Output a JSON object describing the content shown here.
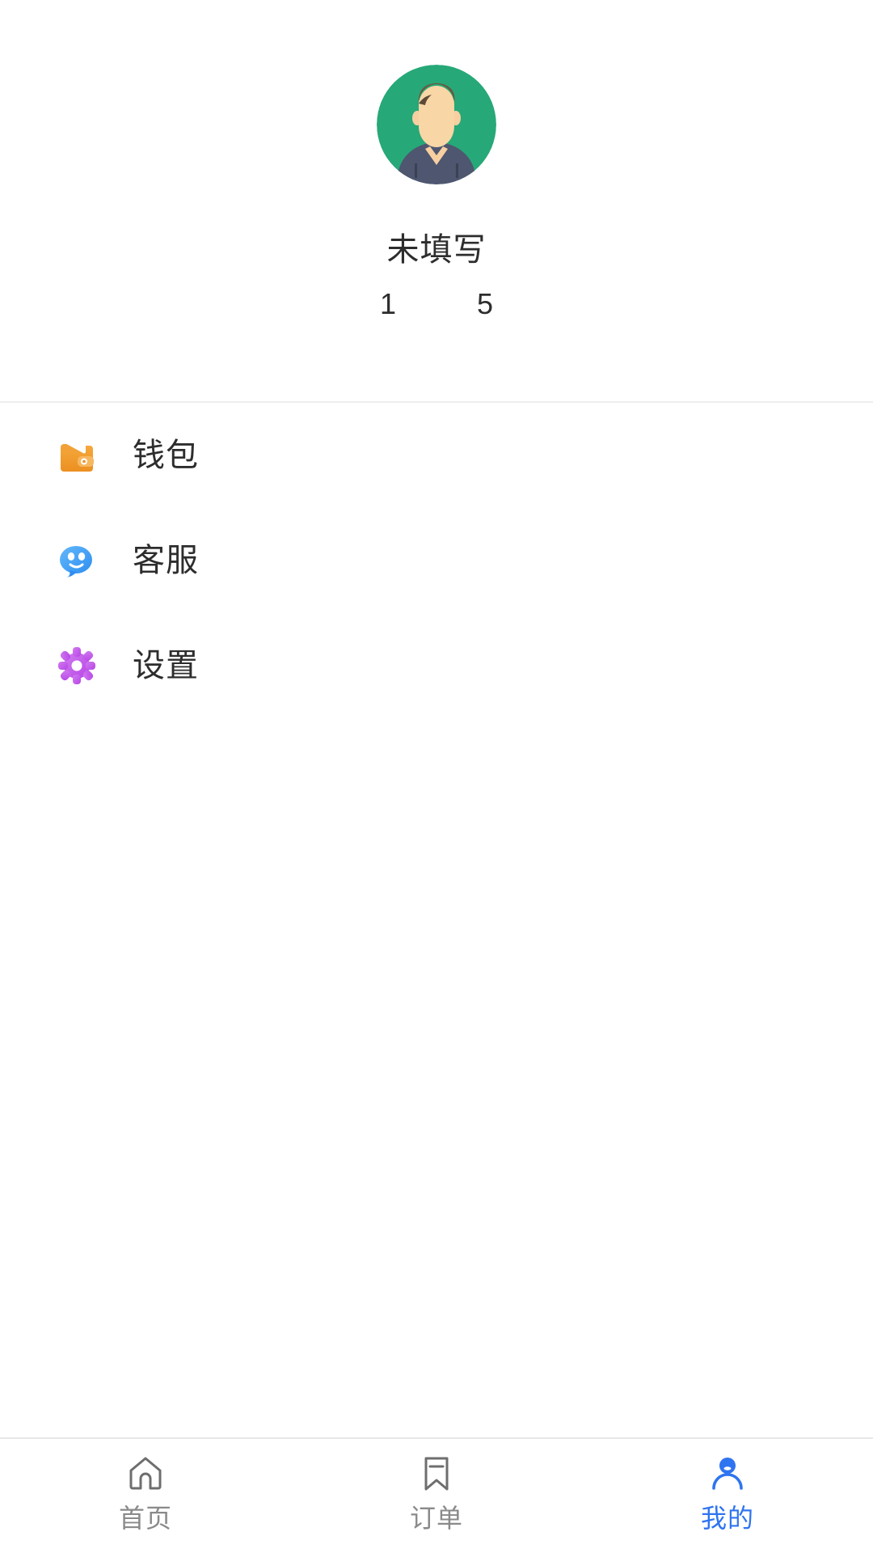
{
  "screen": {
    "name": "mine-profile-screen",
    "background": "#ffffff"
  },
  "profile": {
    "avatar_icon": "user-avatar-illustration",
    "avatar_bg_color": "#27a878",
    "name": "未填写",
    "phone_prefix": "1",
    "phone_masked": "          ",
    "phone_suffix": "5",
    "phone_full": "1          5"
  },
  "menu": {
    "items": [
      {
        "id": "wallet",
        "label": "钱包",
        "icon": "wallet-icon",
        "color": "#f0992e"
      },
      {
        "id": "support",
        "label": "客服",
        "icon": "headset-chat-icon",
        "color": "#49a7f5"
      },
      {
        "id": "settings",
        "label": "设置",
        "icon": "gear-icon",
        "color": "#c157e8"
      }
    ]
  },
  "tabbar": {
    "active_color": "#2f74f0",
    "inactive_color": "#8a8a8a",
    "items": [
      {
        "id": "home",
        "label": "首页",
        "icon": "home-icon",
        "active": false
      },
      {
        "id": "order",
        "label": "订单",
        "icon": "bookmark-icon",
        "active": false
      },
      {
        "id": "mine",
        "label": "我的",
        "icon": "person-icon",
        "active": true
      }
    ]
  }
}
